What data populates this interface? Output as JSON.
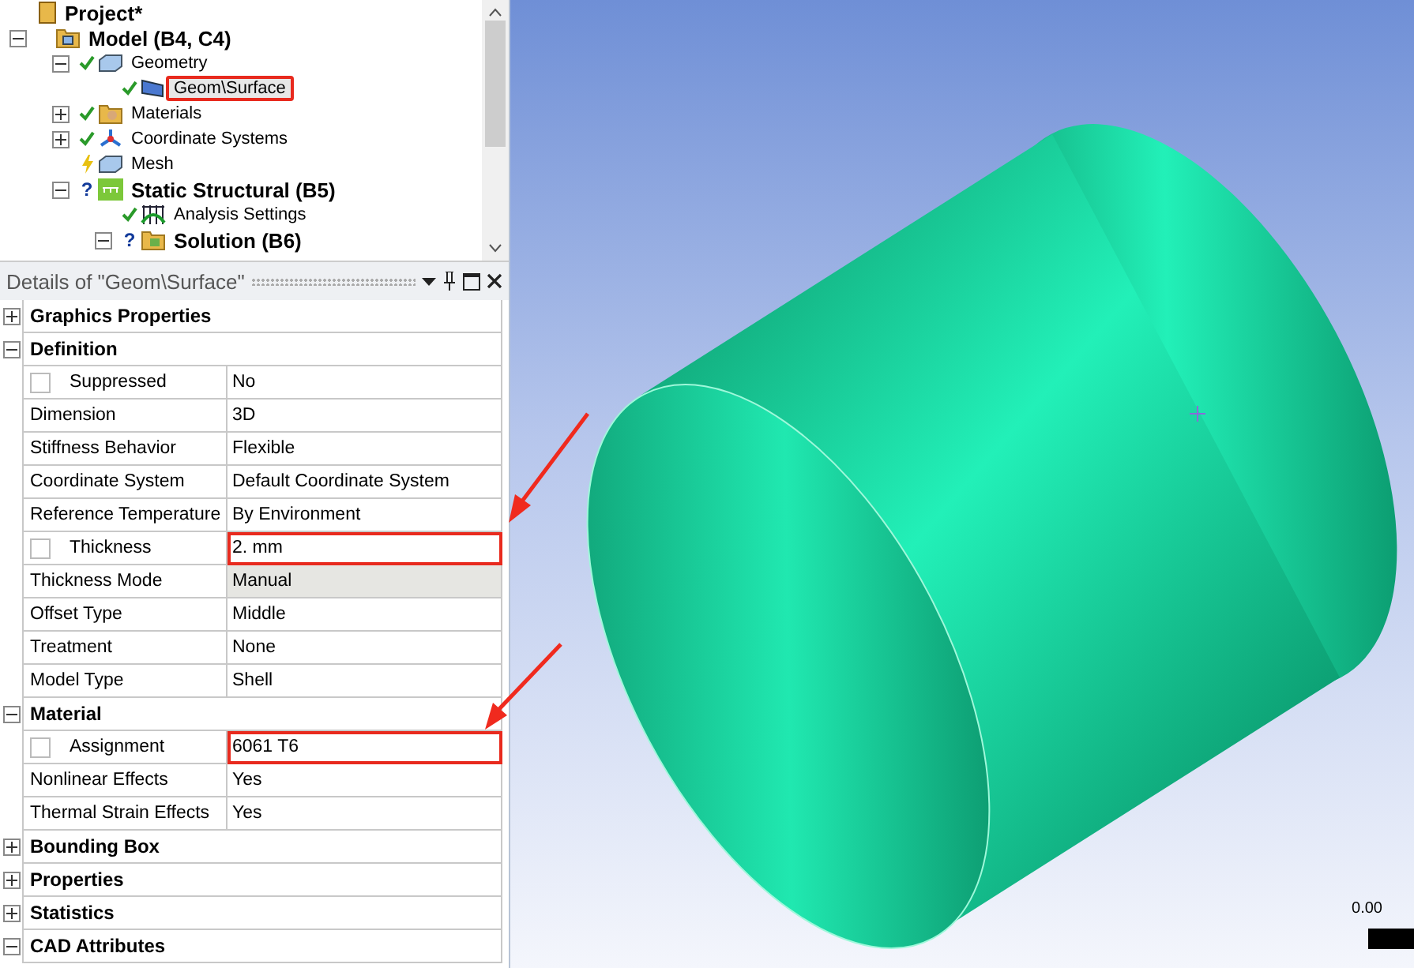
{
  "tree": {
    "items": [
      {
        "label": "Project*",
        "kind": "project",
        "bold": true,
        "children": [
          {
            "label": "Model (B4, C4)",
            "kind": "model",
            "bold": true,
            "expanded": true,
            "children": [
              {
                "label": "Geometry",
                "kind": "geometry",
                "bold": false,
                "solved": true,
                "expanded": true,
                "children": [
                  {
                    "label": "Geom\\Surface",
                    "kind": "surface",
                    "bold": false,
                    "solved": true,
                    "selected": true,
                    "highlighted": true
                  }
                ]
              },
              {
                "label": "Materials",
                "kind": "materials",
                "bold": false,
                "solved": true,
                "expanded": false
              },
              {
                "label": "Coordinate Systems",
                "kind": "coordinates",
                "bold": false,
                "solved": true,
                "expanded": false
              },
              {
                "label": "Mesh",
                "kind": "mesh",
                "bold": false,
                "solved": false,
                "outdated": true
              },
              {
                "label": "Static Structural (B5)",
                "kind": "analysis",
                "bold": true,
                "solved": false,
                "mark": "?",
                "expanded": true,
                "children": [
                  {
                    "label": "Analysis Settings",
                    "kind": "settings",
                    "bold": false,
                    "solved": true
                  },
                  {
                    "label": "Solution (B6)",
                    "kind": "solution",
                    "bold": true,
                    "solved": false,
                    "mark": "?",
                    "expanded": true
                  }
                ]
              }
            ]
          }
        ]
      }
    ]
  },
  "details": {
    "title": "Details of \"Geom\\Surface\"",
    "rows": [
      {
        "kind": "category",
        "label": "Graphics Properties",
        "expanded": false
      },
      {
        "kind": "category",
        "label": "Definition",
        "expanded": true
      },
      {
        "kind": "property",
        "label": "Suppressed",
        "value": "No",
        "checked": false
      },
      {
        "kind": "property",
        "label": "Dimension",
        "value": "3D"
      },
      {
        "kind": "property",
        "label": "Stiffness Behavior",
        "value": "Flexible"
      },
      {
        "kind": "property",
        "label": "Coordinate System",
        "value": "Default Coordinate System"
      },
      {
        "kind": "property",
        "label": "Reference Temperature",
        "value": "By Environment"
      },
      {
        "kind": "property",
        "label": "Thickness",
        "value": "2. mm",
        "checked": false,
        "highlighted": true
      },
      {
        "kind": "property",
        "label": "Thickness Mode",
        "value": "Manual",
        "readonly": true
      },
      {
        "kind": "property",
        "label": "Offset Type",
        "value": "Middle"
      },
      {
        "kind": "property",
        "label": "Treatment",
        "value": "None"
      },
      {
        "kind": "property",
        "label": "Model Type",
        "value": "Shell"
      },
      {
        "kind": "category",
        "label": "Material",
        "expanded": true
      },
      {
        "kind": "property",
        "label": "Assignment",
        "value": "6061 T6",
        "checked": false,
        "highlighted": true
      },
      {
        "kind": "property",
        "label": "Nonlinear Effects",
        "value": "Yes"
      },
      {
        "kind": "property",
        "label": "Thermal Strain Effects",
        "value": "Yes"
      },
      {
        "kind": "category",
        "label": "Bounding Box",
        "expanded": false
      },
      {
        "kind": "category",
        "label": "Properties",
        "expanded": false
      },
      {
        "kind": "category",
        "label": "Statistics",
        "expanded": false
      },
      {
        "kind": "category",
        "label": "CAD Attributes",
        "expanded": true
      }
    ]
  },
  "viewport": {
    "scale_label": "0.00"
  }
}
